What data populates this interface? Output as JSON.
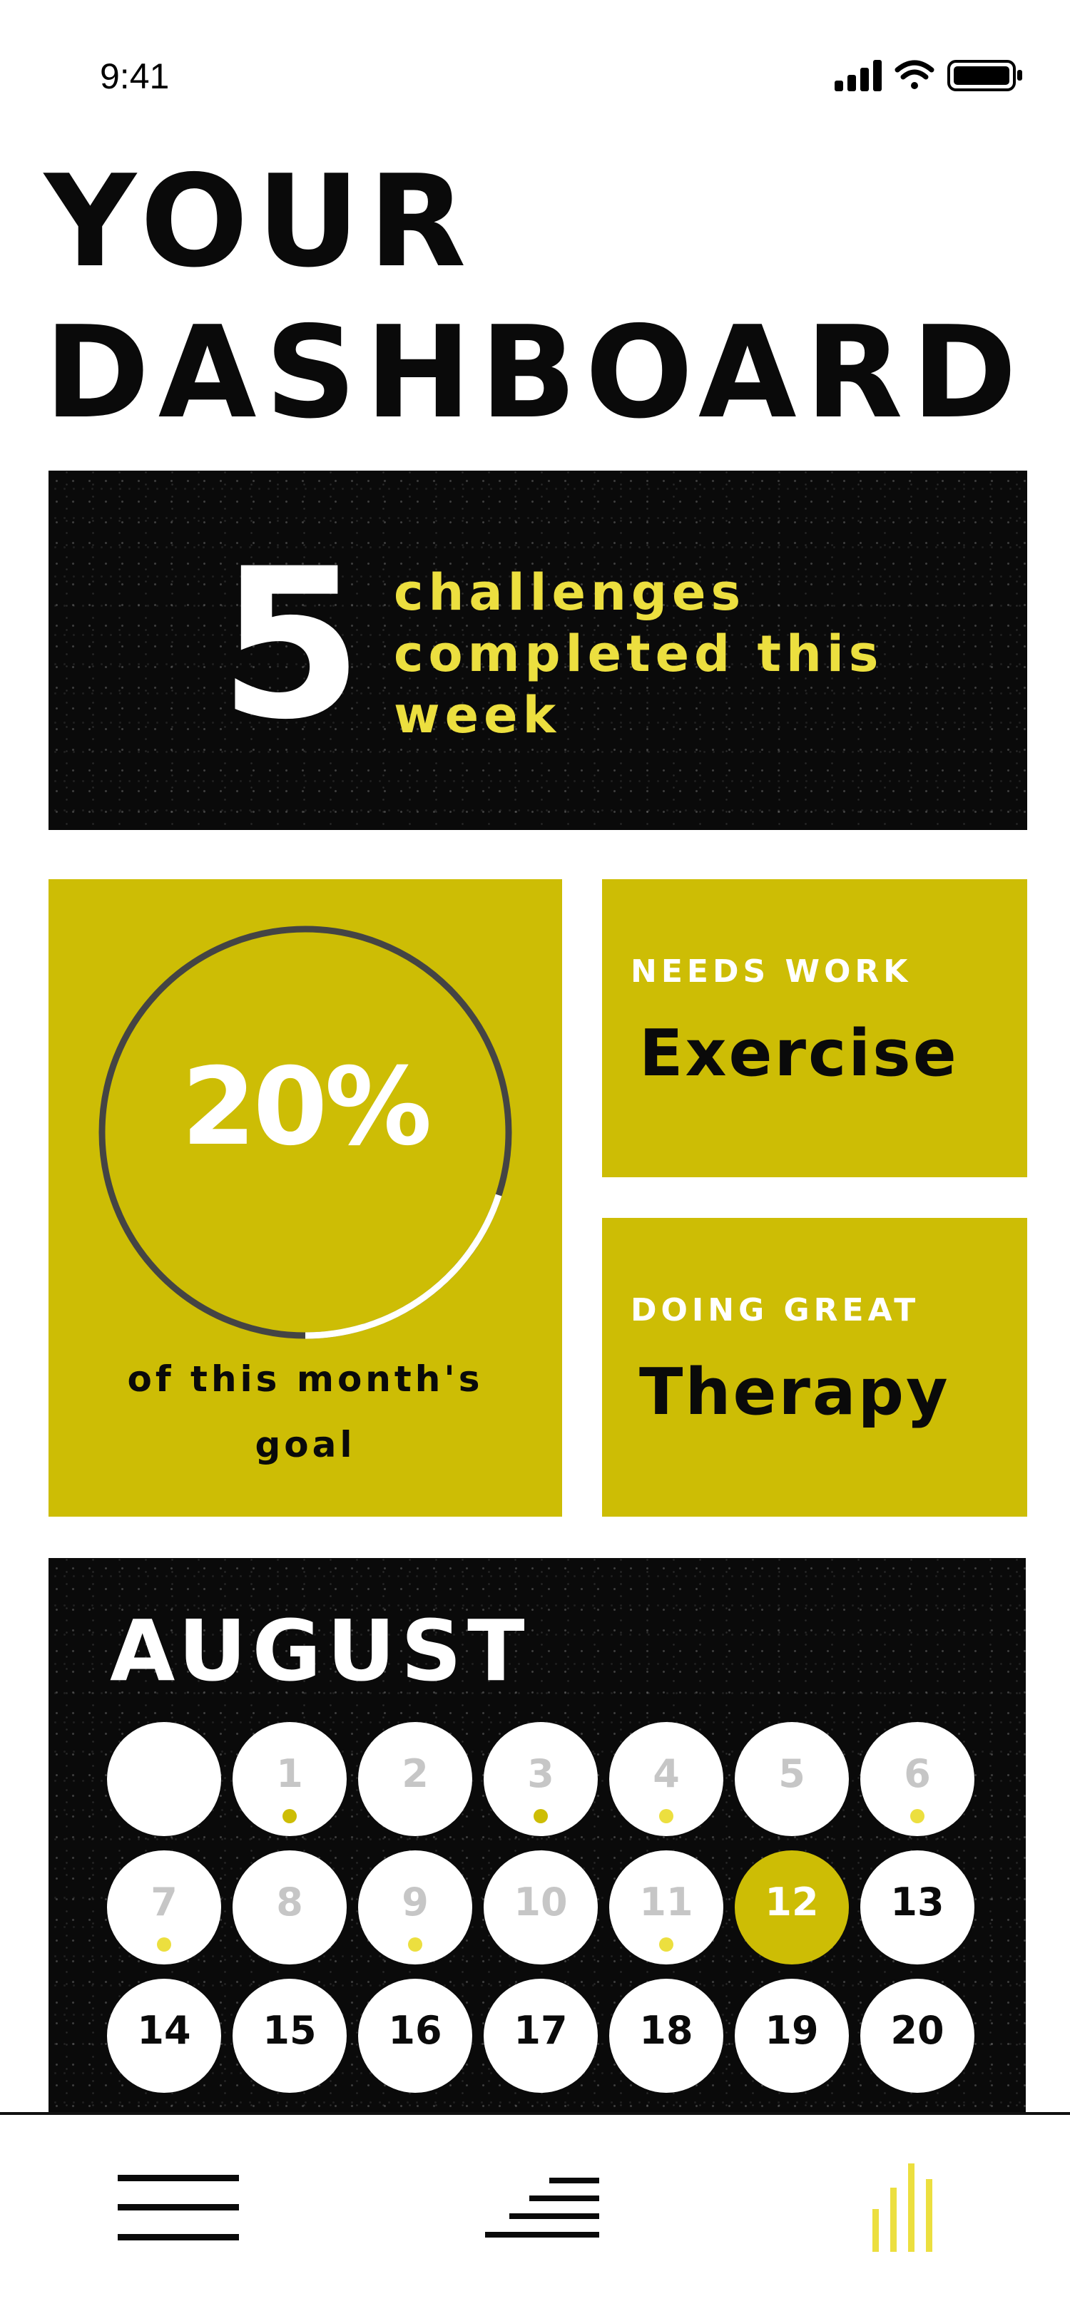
{
  "status_bar": {
    "time": "9:41"
  },
  "header": {
    "title_line1": "YOUR",
    "title_line2": "DASHBOARD"
  },
  "challenges": {
    "count": "5",
    "label": "challenges completed this week"
  },
  "goal": {
    "percent_label": "20%",
    "progress": 0.2,
    "caption": "of this month's goal"
  },
  "needs_work": {
    "eyebrow": "NEEDS WORK",
    "value": "Exercise"
  },
  "doing_great": {
    "eyebrow": "DOING GREAT",
    "value": "Therapy"
  },
  "calendar": {
    "month": "AUGUST",
    "days": [
      {
        "day": "",
        "state": "empty",
        "dot": ""
      },
      {
        "day": "1",
        "state": "past",
        "dot": "dark"
      },
      {
        "day": "2",
        "state": "past",
        "dot": ""
      },
      {
        "day": "3",
        "state": "past",
        "dot": "dark"
      },
      {
        "day": "4",
        "state": "past",
        "dot": "bright"
      },
      {
        "day": "5",
        "state": "past",
        "dot": ""
      },
      {
        "day": "6",
        "state": "past",
        "dot": "bright"
      },
      {
        "day": "7",
        "state": "past",
        "dot": "bright"
      },
      {
        "day": "8",
        "state": "past",
        "dot": ""
      },
      {
        "day": "9",
        "state": "past",
        "dot": "bright"
      },
      {
        "day": "10",
        "state": "past",
        "dot": ""
      },
      {
        "day": "11",
        "state": "past",
        "dot": "bright"
      },
      {
        "day": "12",
        "state": "today",
        "dot": ""
      },
      {
        "day": "13",
        "state": "future",
        "dot": ""
      },
      {
        "day": "14",
        "state": "future",
        "dot": ""
      },
      {
        "day": "15",
        "state": "future",
        "dot": ""
      },
      {
        "day": "16",
        "state": "future",
        "dot": ""
      },
      {
        "day": "17",
        "state": "future",
        "dot": ""
      },
      {
        "day": "18",
        "state": "future",
        "dot": ""
      },
      {
        "day": "19",
        "state": "future",
        "dot": ""
      },
      {
        "day": "20",
        "state": "future",
        "dot": ""
      }
    ]
  },
  "nav": {
    "items": [
      {
        "icon": "menu-icon",
        "active": false
      },
      {
        "icon": "steps-icon",
        "active": false
      },
      {
        "icon": "bar-chart-icon",
        "active": true
      }
    ]
  },
  "colors": {
    "accent_yellow": "#cdbd05",
    "challenge_text": "#ecdf3f",
    "dark_panel": "#0a0a0a",
    "dot_dark": "#cdbd05",
    "dot_bright": "#ecdf3f",
    "nav_active": "#ecdf3f"
  }
}
